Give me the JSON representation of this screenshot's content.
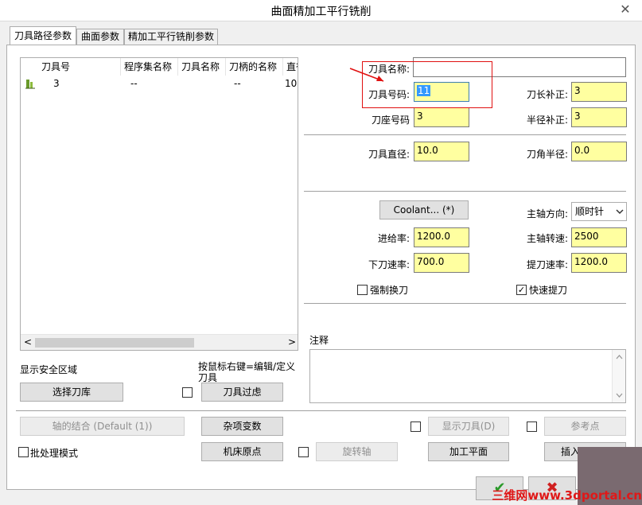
{
  "window": {
    "title": "曲面精加工平行铣削",
    "close_glyph": "✕"
  },
  "tabs": [
    {
      "label": "刀具路径参数"
    },
    {
      "label": "曲面参数"
    },
    {
      "label": "精加工平行铣削参数"
    }
  ],
  "tool_list": {
    "columns": [
      "刀具号",
      "程序集名称",
      "刀具名称",
      "刀柄的名称",
      "直径"
    ],
    "rows": [
      {
        "num": "3",
        "program": "--",
        "name": "",
        "holder": "--",
        "diameter": "10"
      }
    ],
    "scroll_left": "<",
    "scroll_right": ">"
  },
  "tool_params": {
    "name_label": "刀具名称:",
    "name_value": "",
    "number_label": "刀具号码:",
    "number_value": "11",
    "length_comp_label": "刀长补正:",
    "length_comp_value": "3",
    "holder_num_label": "刀座号码",
    "holder_num_value": "3",
    "radius_comp_label": "半径补正:",
    "radius_comp_value": "3",
    "diameter_label": "刀具直径:",
    "diameter_value": "10.0",
    "corner_radius_label": "刀角半径:",
    "corner_radius_value": "0.0"
  },
  "cutting": {
    "coolant_label": "Coolant... (*)",
    "spindle_dir_label": "主轴方向:",
    "spindle_dir_value": "顺时针",
    "feed_label": "进给率:",
    "feed_value": "1200.0",
    "spindle_speed_label": "主轴转速:",
    "spindle_speed_value": "2500",
    "plunge_label": "下刀速率:",
    "plunge_value": "700.0",
    "retract_label": "提刀速率:",
    "retract_value": "1200.0",
    "force_tool_change_label": "强制换刀",
    "force_tool_change_checked": false,
    "rapid_retract_label": "快速提刀",
    "rapid_retract_checked": true
  },
  "notes": {
    "label": "注释",
    "value": ""
  },
  "left_actions": {
    "show_safe_zone": "显示安全区域",
    "right_click_hint": "按鼠标右键=编辑/定义刀具",
    "select_library": "选择刀库",
    "tool_filter": "刀具过虑"
  },
  "bottom_buttons": {
    "axis_combo": "轴的结合 (Default (1))",
    "misc_vars": "杂项变数",
    "show_tool": "显示刀具(D)",
    "ref_point": "参考点",
    "batch_mode": "批处理模式",
    "machine_origin": "机床原点",
    "rotary_axis": "旋转轴",
    "work_plane": "加工平面",
    "insert": "插入"
  },
  "dialog": {
    "ok_glyph": "✔",
    "cancel_glyph": "✖",
    "watermark": "三维网www.3dportal.cn"
  },
  "colors": {
    "field_yellow": "#ffffa0",
    "highlight_red": "#e01010",
    "selection_blue": "#3399ff"
  }
}
